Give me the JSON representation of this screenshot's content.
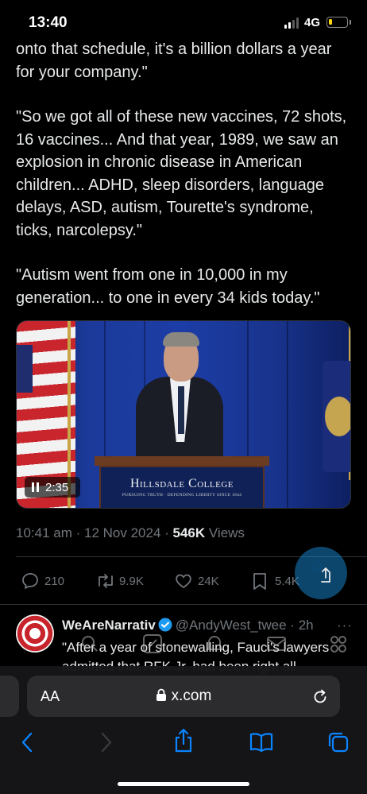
{
  "status_bar": {
    "time": "13:40",
    "network": "4G",
    "battery_level": 0.2
  },
  "tweet": {
    "paragraphs": [
      "onto that schedule, it's a billion dollars a year for your company.\"",
      "\"So we got all of these new vaccines, 72 shots, 16 vaccines... And that year, 1989, we saw an explosion in chronic disease in American children... ADHD, sleep disorders, language delays, ASD, autism, Tourette's syndrome, ticks, narcolepsy.\"",
      "\"Autism went from one in 10,000 in my generation... to one in every 34 kids today.\""
    ],
    "video": {
      "duration": "2:35",
      "podium_title": "Hillsdale College",
      "podium_subtitle": "PURSUING TRUTH · DEFENDING LIBERTY SINCE 1844"
    },
    "meta": {
      "timestamp": "10:41 am · 12 Nov 2024 · ",
      "views_count": "546K",
      "views_label": " Views"
    },
    "actions": {
      "replies": "210",
      "reposts": "9.9K",
      "likes": "24K",
      "bookmarks": "5.4K"
    }
  },
  "reply": {
    "name": "WeAreNarrativ",
    "handle": "@AndyWest_twee · 2h",
    "more": "···",
    "text": "\"After a year of stonewalling, Fauci's lawyers admitted that RFK Jr. had been right all"
  },
  "browser": {
    "text_size_label": "AA",
    "url": "x.com"
  },
  "colors": {
    "accent": "#1d9bf0",
    "muted": "#71767b",
    "text": "#e7e9ea",
    "safari_blue": "#0a84ff"
  }
}
